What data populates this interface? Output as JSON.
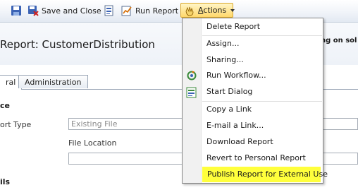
{
  "toolbar": {
    "save_close_label": "Save and Close",
    "run_report_label": "Run Report",
    "actions_label": "Actions",
    "actions_access_key": "A",
    "actions_rest": "ctions",
    "icons": [
      "save-icon",
      "save-close-icon",
      "report-properties-icon",
      "run-report-icon",
      "actions-hand-icon",
      "chevron-down-icon"
    ]
  },
  "header": {
    "title": "Report: CustomerDistribution",
    "right_text": "ng on sol"
  },
  "tabs": [
    {
      "label": "ral",
      "active": true
    },
    {
      "label": "Administration",
      "active": false
    }
  ],
  "form": {
    "section1": "ce",
    "report_type_label": "ort Type",
    "report_type_value": "Existing File",
    "file_location_label": "File Location",
    "file_location_value": "",
    "section2": "ils"
  },
  "menu": {
    "items": [
      {
        "label": "Delete Report",
        "icon": ""
      },
      {
        "label": "Assign...",
        "icon": ""
      },
      {
        "label": "Sharing...",
        "icon": ""
      },
      {
        "label": "Run Workflow...",
        "icon": "run-workflow-icon"
      },
      {
        "label": "Start Dialog",
        "icon": "start-dialog-icon"
      },
      {
        "label": "Copy a Link",
        "icon": ""
      },
      {
        "label": "E-mail a Link...",
        "icon": ""
      },
      {
        "label": "Download Report",
        "icon": ""
      },
      {
        "label": "Revert to Personal Report",
        "icon": ""
      },
      {
        "label": "Publish Report for External Use",
        "icon": "",
        "highlighted": true
      }
    ]
  },
  "colors": {
    "highlight": "#ffff3c",
    "actions_button": "#ffd86b",
    "toolbar_bg": "#eef2f8"
  }
}
